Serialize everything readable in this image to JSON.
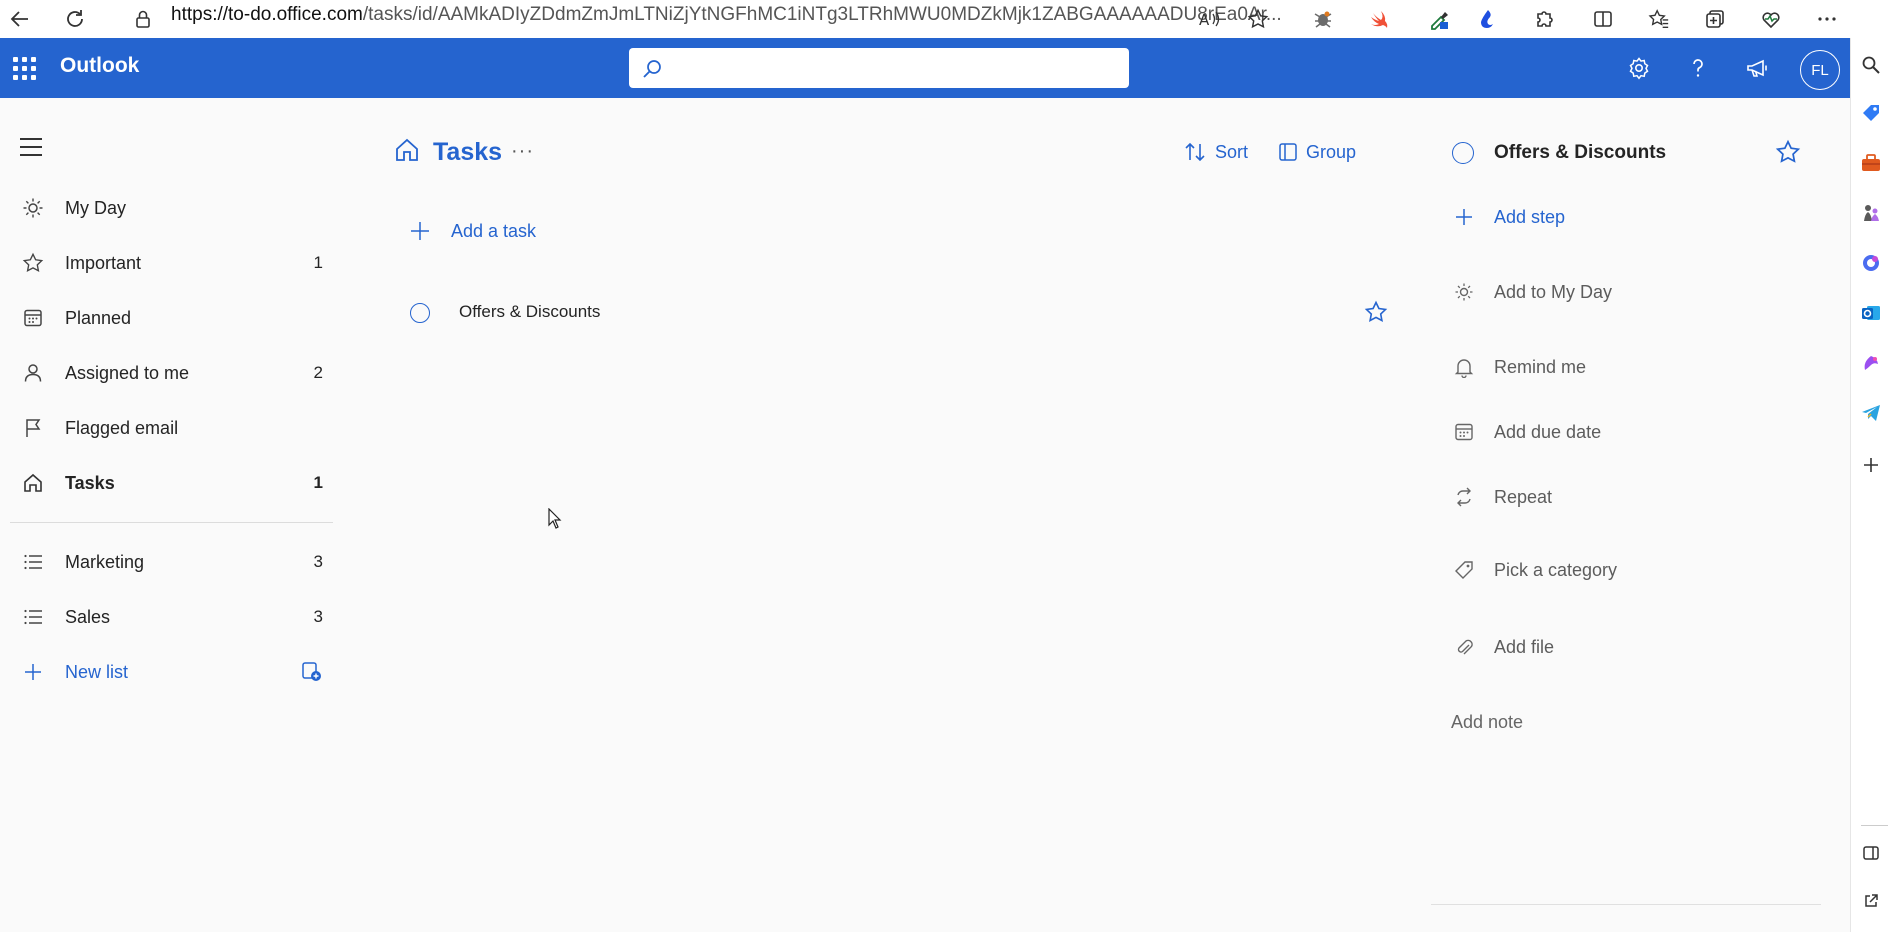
{
  "browser": {
    "url_host": "https://to-do.office.com",
    "url_path": "/tasks/id/AAMkADIyZDdmZmJmLTNiZjYtNGFhMC1iNTg3LTRhMWU0MDZkMjk1ZABGAAAAAADU8rEa0Ar..."
  },
  "header": {
    "app_name": "Outlook",
    "search_placeholder": "",
    "avatar_initials": "FL"
  },
  "nav": {
    "items": [
      {
        "label": "My Day",
        "count": "",
        "icon": "sun-icon"
      },
      {
        "label": "Important",
        "count": "1",
        "icon": "star-icon"
      },
      {
        "label": "Planned",
        "count": "",
        "icon": "calendar-icon"
      },
      {
        "label": "Assigned to me",
        "count": "2",
        "icon": "person-icon"
      },
      {
        "label": "Flagged email",
        "count": "",
        "icon": "flag-icon"
      },
      {
        "label": "Tasks",
        "count": "1",
        "icon": "home-icon"
      }
    ],
    "lists": [
      {
        "label": "Marketing",
        "count": "3"
      },
      {
        "label": "Sales",
        "count": "3"
      }
    ],
    "new_list_label": "New list"
  },
  "main": {
    "title": "Tasks",
    "more": "···",
    "sort_label": "Sort",
    "group_label": "Group",
    "add_task_label": "Add a task",
    "tasks": [
      {
        "title": "Offers & Discounts",
        "starred": false
      }
    ]
  },
  "details": {
    "title": "Offers & Discounts",
    "add_step": "Add step",
    "add_to_my_day": "Add to My Day",
    "remind_me": "Remind me",
    "add_due_date": "Add due date",
    "repeat": "Repeat",
    "pick_category": "Pick a category",
    "add_file": "Add file",
    "add_note": "Add note"
  },
  "colors": {
    "accent": "#2564cf",
    "background": "#fafafa"
  }
}
